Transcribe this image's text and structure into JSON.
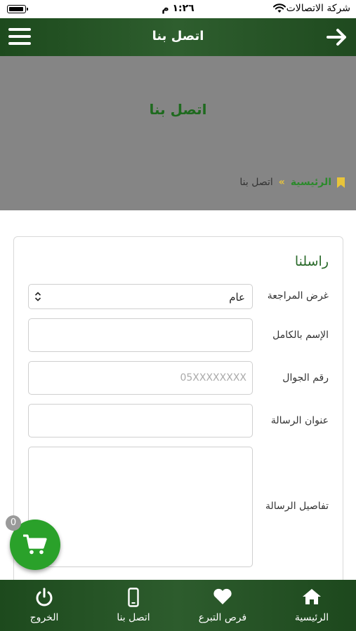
{
  "status_bar": {
    "carrier": "شركة الاتصالات",
    "time": "١:٢٦ م"
  },
  "header": {
    "title": "اتصل بنا",
    "back_icon": "arrow-right-icon",
    "menu_icon": "hamburger-menu-icon"
  },
  "hero": {
    "title": "اتصل بنا",
    "breadcrumb": {
      "home": "الرئيسية",
      "separator": "»",
      "current": "اتصل بنا"
    }
  },
  "form": {
    "section_title": "راسلنا",
    "purpose": {
      "label": "غرض المراجعة",
      "value": "عام"
    },
    "full_name": {
      "label": "الإسم بالكامل",
      "value": "",
      "placeholder": ""
    },
    "mobile": {
      "label": "رقم الجوال",
      "value": "",
      "placeholder": "05XXXXXXXX"
    },
    "subject": {
      "label": "عنوان الرسالة",
      "value": "",
      "placeholder": ""
    },
    "details": {
      "label": "تفاصيل الرسالة",
      "value": "",
      "placeholder": ""
    }
  },
  "cart": {
    "count": "0",
    "icon": "shopping-cart-icon"
  },
  "tab_bar": {
    "items": [
      {
        "label": "الرئيسية",
        "icon": "home-icon"
      },
      {
        "label": "فرص التبرع",
        "icon": "heart-icon"
      },
      {
        "label": "اتصل بنا",
        "icon": "phone-icon"
      },
      {
        "label": "الخروج",
        "icon": "power-icon"
      }
    ]
  },
  "colors": {
    "header_green": "#2e5e2e",
    "accent_green": "#2aa12a",
    "title_green": "#1e6a1e",
    "hero_gray": "#858585",
    "breadcrumb_gold": "#e8c43a"
  }
}
